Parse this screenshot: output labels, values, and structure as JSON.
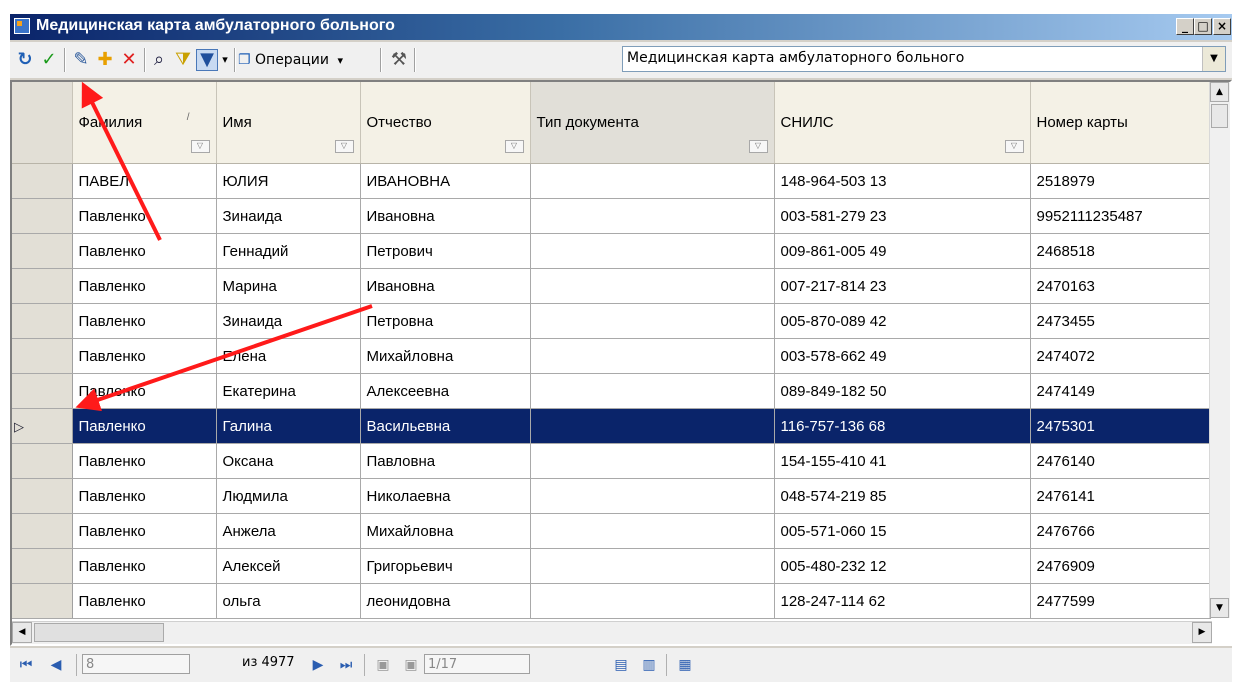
{
  "window": {
    "title": "Медицинская карта амбулаторного больного",
    "controls": [
      "_",
      "□",
      "×"
    ]
  },
  "toolbar": {
    "operations_label": "Операции",
    "operations_arrow": "▾",
    "filter_arrow": "▾",
    "form_selector_value": "Медицинская карта амбулаторного больного"
  },
  "grid": {
    "columns": [
      {
        "label": "Фамилия",
        "width": 144
      },
      {
        "label": "Имя",
        "width": 144
      },
      {
        "label": "Отчество",
        "width": 170
      },
      {
        "label": "Тип документа",
        "width": 244
      },
      {
        "label": "СНИЛС",
        "width": 256
      },
      {
        "label": "Номер карты",
        "width": 180
      }
    ],
    "selected_row_index": 7,
    "rows": [
      [
        "ПАВЕЛ",
        "ЮЛИЯ",
        "ИВАНОВНА",
        "",
        "148-964-503 13",
        "2518979"
      ],
      [
        "Павленко",
        "Зинаида",
        "Ивановна",
        "",
        "003-581-279 23",
        "9952111235487"
      ],
      [
        "Павленко",
        "Геннадий",
        "Петрович",
        "",
        "009-861-005 49",
        "2468518"
      ],
      [
        "Павленко",
        "Марина",
        "Ивановна",
        "",
        "007-217-814 23",
        "2470163"
      ],
      [
        "Павленко",
        "Зинаида",
        "Петровна",
        "",
        "005-870-089 42",
        "2473455"
      ],
      [
        "Павленко",
        "Елена",
        "Михайловна",
        "",
        "003-578-662 49",
        "2474072"
      ],
      [
        "Павленко",
        "Екатерина",
        "Алексеевна",
        "",
        "089-849-182 50",
        "2474149"
      ],
      [
        "Павленко",
        "Галина",
        "Васильевна",
        "",
        "116-757-136 68",
        "2475301"
      ],
      [
        "Павленко",
        "Оксана",
        "Павловна",
        "",
        "154-155-410 41",
        "2476140"
      ],
      [
        "Павленко",
        "Людмила",
        "Николаевна",
        "",
        "048-574-219 85",
        "2476141"
      ],
      [
        "Павленко",
        "Анжела",
        "Михайловна",
        "",
        "005-571-060 15",
        "2476766"
      ],
      [
        "Павленко",
        "Алексей",
        "Григорьевич",
        "",
        "005-480-232 12",
        "2476909"
      ],
      [
        "Павленко",
        "ольга",
        "леонидовна",
        "",
        "128-247-114 62",
        "2477599"
      ]
    ],
    "current_row_marker": "▷"
  },
  "navigator": {
    "position_value": "8",
    "of_count": "из 4977",
    "page_value": "1/17"
  },
  "colors": {
    "selection": "#0a246a",
    "annotation_arrow": "#ff1a1a",
    "title_gradient_start": "#0a246a"
  }
}
